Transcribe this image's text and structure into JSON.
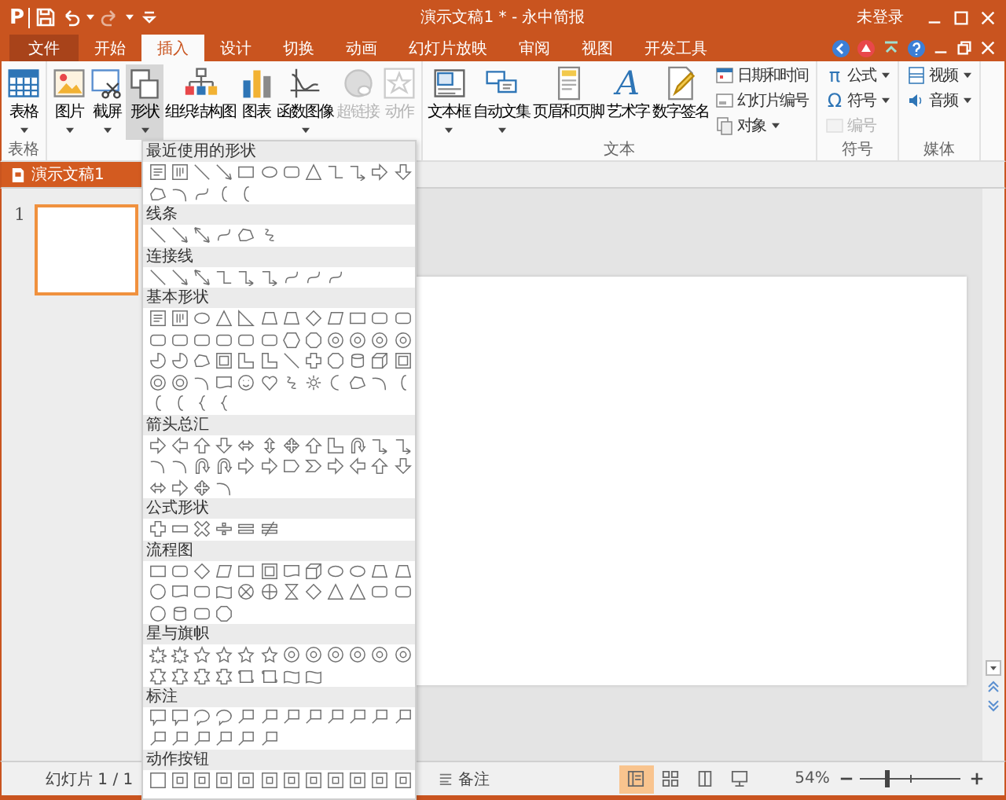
{
  "quick_access": {
    "logo": "P"
  },
  "title": "演示文稿1 * - 永中简报",
  "account": "未登录",
  "tabs": [
    {
      "label": "文件",
      "kind": "file",
      "selected": false
    },
    {
      "label": "开始",
      "kind": "tab",
      "selected": false
    },
    {
      "label": "插入",
      "kind": "tab",
      "selected": true
    },
    {
      "label": "设计",
      "kind": "tab",
      "selected": false
    },
    {
      "label": "切换",
      "kind": "tab",
      "selected": false
    },
    {
      "label": "动画",
      "kind": "tab",
      "selected": false
    },
    {
      "label": "幻灯片放映",
      "kind": "tab",
      "selected": false
    },
    {
      "label": "审阅",
      "kind": "tab",
      "selected": false
    },
    {
      "label": "视图",
      "kind": "tab",
      "selected": false
    },
    {
      "label": "开发工具",
      "kind": "tab",
      "selected": false
    }
  ],
  "ribbon": [
    {
      "label": "表格",
      "items": [
        {
          "kind": "large",
          "label": "表格",
          "dropdown": true,
          "disabled": false,
          "selected": false
        }
      ]
    },
    {
      "items": [
        {
          "kind": "large",
          "label": "图片",
          "dropdown": true,
          "disabled": false,
          "selected": false
        },
        {
          "kind": "large",
          "label": "截屏",
          "dropdown": true,
          "disabled": false,
          "selected": false
        },
        {
          "kind": "large",
          "label": "形状",
          "dropdown": true,
          "disabled": false,
          "selected": true
        },
        {
          "kind": "large",
          "label": "组织结构图",
          "dropdown": false,
          "disabled": false,
          "selected": false
        },
        {
          "kind": "large",
          "label": "图表",
          "dropdown": false,
          "disabled": false,
          "selected": false
        },
        {
          "kind": "large",
          "label": "函数图像",
          "dropdown": true,
          "disabled": false,
          "selected": false
        },
        {
          "kind": "large",
          "label": "超链接",
          "dropdown": false,
          "disabled": true,
          "selected": false
        },
        {
          "kind": "large",
          "label": "动作",
          "dropdown": false,
          "disabled": true,
          "selected": false
        }
      ]
    },
    {
      "label": "文本",
      "items": [
        {
          "kind": "large",
          "label": "文本框",
          "dropdown": true,
          "disabled": false,
          "selected": false
        },
        {
          "kind": "large",
          "label": "自动文集",
          "dropdown": true,
          "disabled": false,
          "selected": false
        },
        {
          "kind": "large",
          "label": "页眉和页脚",
          "dropdown": false,
          "disabled": false,
          "selected": false
        },
        {
          "kind": "large",
          "label": "艺术字",
          "glyph": "A",
          "dropdown": false,
          "disabled": false,
          "selected": false
        },
        {
          "kind": "large",
          "label": "数字签名",
          "dropdown": false,
          "disabled": false,
          "selected": false
        },
        {
          "kind": "small-column",
          "entries": [
            {
              "label": "日期和时间",
              "dropdown": false,
              "disabled": false
            },
            {
              "label": "幻灯片编号",
              "dropdown": false,
              "disabled": false
            },
            {
              "label": "对象",
              "dropdown": true,
              "disabled": false
            }
          ]
        }
      ]
    },
    {
      "label": "符号",
      "items": [
        {
          "kind": "small-column",
          "entries": [
            {
              "label": "公式",
              "glyph": "π",
              "dropdown": true,
              "disabled": false
            },
            {
              "label": "符号",
              "glyph": "Ω",
              "dropdown": true,
              "disabled": false
            },
            {
              "label": "编号",
              "dropdown": false,
              "disabled": true
            }
          ]
        }
      ]
    },
    {
      "label": "媒体",
      "items": [
        {
          "kind": "small-column",
          "entries": [
            {
              "label": "视频",
              "dropdown": true,
              "disabled": false
            },
            {
              "label": "音频",
              "dropdown": true,
              "disabled": false
            }
          ]
        }
      ]
    }
  ],
  "document_tab": {
    "label": "演示文稿1"
  },
  "slides": [
    {
      "number": "1",
      "selected": true
    }
  ],
  "shapes_menu": {
    "sections": [
      {
        "title": "最近使用的形状"
      },
      {
        "title": "线条"
      },
      {
        "title": "连接线"
      },
      {
        "title": "基本形状"
      },
      {
        "title": "箭头总汇"
      },
      {
        "title": "公式形状"
      },
      {
        "title": "流程图"
      },
      {
        "title": "星与旗帜"
      },
      {
        "title": "标注"
      },
      {
        "title": "动作按钮"
      }
    ]
  },
  "status_bar": {
    "slide_count": "幻灯片 1 / 1",
    "notes": "备注",
    "views": [
      {
        "selected": true
      },
      {
        "selected": false
      },
      {
        "selected": false
      },
      {
        "selected": false
      }
    ],
    "zoom": "54%",
    "zoom_slider": {
      "level": 0.27
    }
  }
}
